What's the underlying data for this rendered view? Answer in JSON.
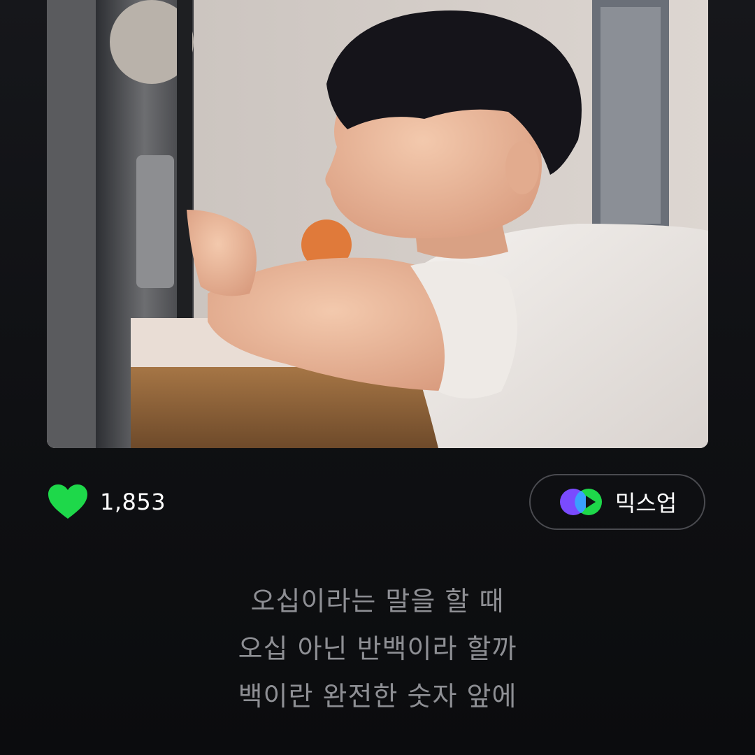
{
  "album_art": {
    "subject": "album-cover-photo"
  },
  "like": {
    "icon": "heart-icon",
    "count": "1,853",
    "color": "#1ed84a"
  },
  "mixup": {
    "icon": "mixup-icon",
    "label": "믹스업",
    "colors": [
      "#7a4bff",
      "#3aa0ff",
      "#1ed84a"
    ]
  },
  "lyrics": [
    "오십이라는 말을 할 때",
    "오십 아닌 반백이라 할까",
    "백이란 완전한 숫자 앞에"
  ]
}
